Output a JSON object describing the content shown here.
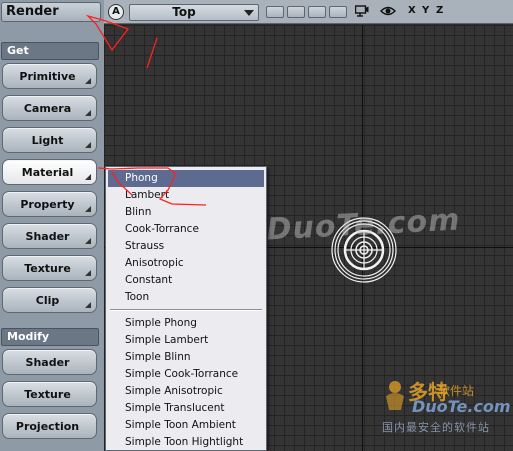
{
  "panel": {
    "mode_title": "Render",
    "sections": {
      "get": "Get",
      "modify": "Modify"
    },
    "get_buttons": [
      "Primitive",
      "Camera",
      "Light",
      "Material",
      "Property",
      "Shader",
      "Texture",
      "Clip"
    ],
    "modify_buttons": [
      "Shader",
      "Texture",
      "Projection"
    ],
    "active_button": "Material"
  },
  "toolbar": {
    "auto_label": "A",
    "view": "Top",
    "axes": [
      "X",
      "Y",
      "Z"
    ],
    "icons": [
      "camera-icon",
      "eye-icon"
    ]
  },
  "menu": {
    "items": [
      "Phong",
      "Lambert",
      "Blinn",
      "Cook-Torrance",
      "Strauss",
      "Anisotropic",
      "Constant",
      "Toon"
    ],
    "simple_items": [
      "Simple Phong",
      "Simple Lambert",
      "Simple Blinn",
      "Simple Cook-Torrance",
      "Simple Anisotropic",
      "Simple Translucent",
      "Simple Toon Ambient",
      "Simple Toon Hightlight"
    ],
    "selected": "Phong"
  },
  "watermark": {
    "text": "www.DuoTe.com"
  },
  "logo": {
    "name": "多特",
    "name_suffix": "软件站",
    "domain": "DuoTe.com",
    "slogan": "国内最安全的软件站"
  },
  "colors": {
    "accent": "#5c6b8f",
    "panel": "#8e9aa6",
    "annotation": "#ff2020"
  }
}
